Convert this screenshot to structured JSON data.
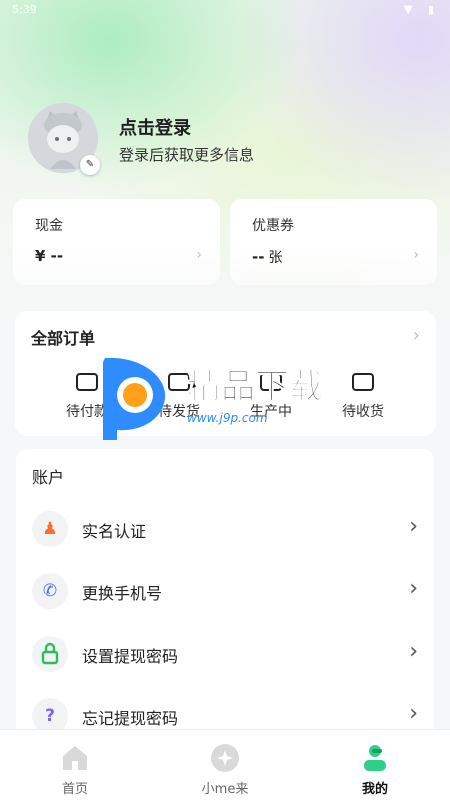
{
  "status_bar": {
    "time": "5:39",
    "icons": "▼ ▮"
  },
  "profile": {
    "login_title": "点击登录",
    "login_subtitle": "登录后获取更多信息",
    "edit_glyph": "✎"
  },
  "wallet": {
    "cash": {
      "label": "现金",
      "value": "¥ --",
      "chevron": "›"
    },
    "coupon": {
      "label": "优惠券",
      "value": "--",
      "unit": "张",
      "chevron": "›"
    }
  },
  "orders": {
    "title": "全部订单",
    "chevron": "›",
    "items": [
      {
        "label": "待付款",
        "icon": "wallet-icon"
      },
      {
        "label": "待发货",
        "icon": "package-icon"
      },
      {
        "label": "生产中",
        "icon": "clock-box-icon"
      },
      {
        "label": "待收货",
        "icon": "truck-icon"
      }
    ]
  },
  "account": {
    "title": "账户",
    "rows": [
      {
        "label": "实名认证",
        "glyph": "♟",
        "color": "#ff6b2c",
        "icon": "real-name-icon"
      },
      {
        "label": "更换手机号",
        "glyph": "✆",
        "color": "#4a6cf7",
        "icon": "phone-icon"
      },
      {
        "label": "设置提现密码",
        "glyph": "🔒",
        "color": "#2ebd59",
        "icon": "lock-icon"
      },
      {
        "label": "忘记提现密码",
        "glyph": "?",
        "color": "#7b61ff",
        "icon": "question-icon"
      }
    ],
    "chevron": "›"
  },
  "watermark": {
    "text": "精品下载",
    "url": "www.j9p.com"
  },
  "tabbar": {
    "tabs": [
      {
        "label": "首页",
        "icon": "home-icon"
      },
      {
        "label": "小me来",
        "icon": "sparkle-icon"
      },
      {
        "label": "我的",
        "icon": "profile-icon",
        "active": true
      }
    ]
  },
  "colors": {
    "accent_green": "#2fcf87",
    "watermark_blue": "#2f8cff",
    "watermark_orange": "#ff9f1a"
  }
}
